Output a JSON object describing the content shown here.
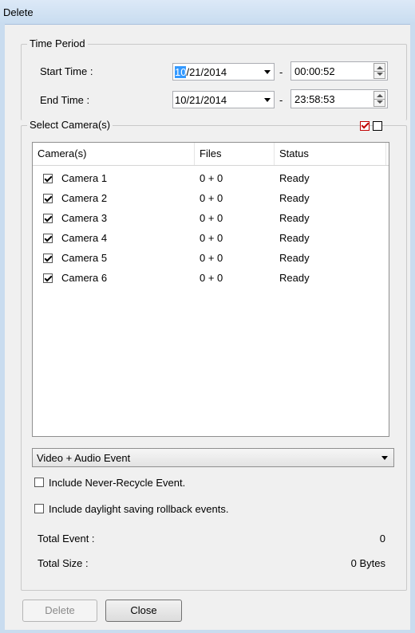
{
  "window": {
    "title": "Delete"
  },
  "time_period": {
    "title": "Time Period",
    "start_label": "Start Time :",
    "start_date_selected": "10",
    "start_date_rest": "/21/2014",
    "start_time": "00:00:52",
    "end_label": "End Time :",
    "end_date": "10/21/2014",
    "end_time": "23:58:53",
    "separator": "-"
  },
  "cameras": {
    "title": "Select Camera(s)",
    "columns": [
      "Camera(s)",
      "Files",
      "Status"
    ],
    "rows": [
      {
        "name": "Camera 1",
        "files": "0 + 0",
        "status": "Ready",
        "checked": true
      },
      {
        "name": "Camera 2",
        "files": "0 + 0",
        "status": "Ready",
        "checked": true
      },
      {
        "name": "Camera 3",
        "files": "0 + 0",
        "status": "Ready",
        "checked": true
      },
      {
        "name": "Camera 4",
        "files": "0 + 0",
        "status": "Ready",
        "checked": true
      },
      {
        "name": "Camera 5",
        "files": "0 + 0",
        "status": "Ready",
        "checked": true
      },
      {
        "name": "Camera 6",
        "files": "0 + 0",
        "status": "Ready",
        "checked": true
      }
    ]
  },
  "event_type": {
    "selected": "Video + Audio Event"
  },
  "options": {
    "never_recycle": {
      "label": "Include Never-Recycle Event.",
      "checked": false
    },
    "daylight": {
      "label": "Include daylight saving rollback events.",
      "checked": false
    }
  },
  "totals": {
    "event_label": "Total Event :",
    "event_value": "0",
    "size_label": "Total Size :",
    "size_value": "0 Bytes"
  },
  "buttons": {
    "delete": "Delete",
    "close": "Close"
  },
  "colors": {
    "selection": "#3399ff",
    "select_all_border": "#c00000"
  }
}
